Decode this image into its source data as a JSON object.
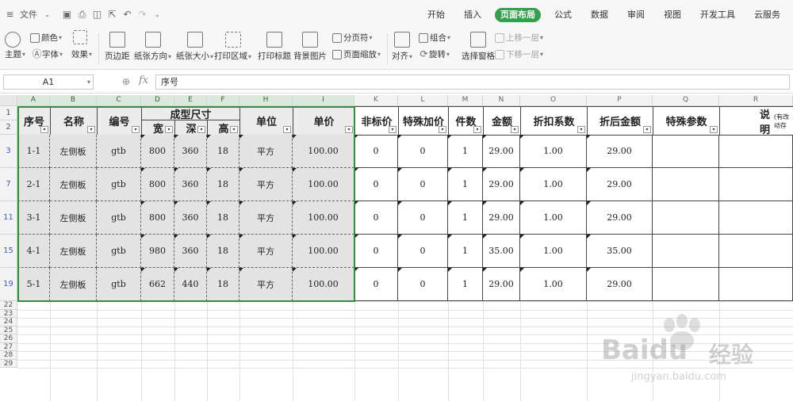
{
  "quick_access": {
    "menu_label": "文件"
  },
  "tabs": [
    "开始",
    "插入",
    "页面布局",
    "公式",
    "数据",
    "审阅",
    "视图",
    "开发工具",
    "云服务"
  ],
  "active_tab_index": 2,
  "ribbon": {
    "theme": "主题",
    "colors": "颜色",
    "fonts": "字体",
    "effects": "效果",
    "margins": "页边距",
    "orientation": "纸张方向",
    "size": "纸张大小",
    "print_area": "打印区域",
    "print_titles": "打印标题",
    "background": "背景图片",
    "breaks": "分页符",
    "page_zoom": "页面缩放",
    "align": "对齐",
    "group": "组合",
    "rotate": "旋转",
    "selection_pane": "选择窗格",
    "bring_forward": "上移一层",
    "send_backward": "下移一层"
  },
  "formula_bar": {
    "cell_ref": "A1",
    "fx": "fx",
    "content": "序号"
  },
  "columns": [
    "A",
    "B",
    "C",
    "D",
    "E",
    "F",
    "H",
    "I",
    "K",
    "L",
    "M",
    "N",
    "O",
    "P",
    "Q",
    "R"
  ],
  "header": {
    "seq": "序号",
    "name": "名称",
    "code": "编号",
    "size_group": "成型尺寸",
    "width": "宽",
    "depth": "深",
    "height": "高",
    "unit": "单位",
    "unit_price": "单价",
    "nonstd_price": "非标价",
    "special_price": "特殊加价",
    "qty": "件数",
    "amount": "金额",
    "discount": "折扣系数",
    "discounted_amount": "折后金额",
    "special_params": "特殊参数",
    "note": "说明",
    "note_hint": "(有改动存"
  },
  "rows": [
    {
      "row_no": "3",
      "seq": "1-1",
      "name": "左侧板",
      "code": "gtb",
      "width": "800",
      "depth": "360",
      "height": "18",
      "unit": "平方",
      "unit_price": "100.00",
      "nonstd": "0",
      "special": "0",
      "qty": "1",
      "amount": "29.00",
      "discount": "1.00",
      "discounted": "29.00"
    },
    {
      "row_no": "7",
      "seq": "2-1",
      "name": "左侧板",
      "code": "gtb",
      "width": "800",
      "depth": "360",
      "height": "18",
      "unit": "平方",
      "unit_price": "100.00",
      "nonstd": "0",
      "special": "0",
      "qty": "1",
      "amount": "29.00",
      "discount": "1.00",
      "discounted": "29.00"
    },
    {
      "row_no": "11",
      "seq": "3-1",
      "name": "左侧板",
      "code": "gtb",
      "width": "800",
      "depth": "360",
      "height": "18",
      "unit": "平方",
      "unit_price": "100.00",
      "nonstd": "0",
      "special": "0",
      "qty": "1",
      "amount": "29.00",
      "discount": "1.00",
      "discounted": "29.00"
    },
    {
      "row_no": "15",
      "seq": "4-1",
      "name": "左侧板",
      "code": "gtb",
      "width": "980",
      "depth": "360",
      "height": "18",
      "unit": "平方",
      "unit_price": "100.00",
      "nonstd": "0",
      "special": "0",
      "qty": "1",
      "amount": "35.00",
      "discount": "1.00",
      "discounted": "35.00"
    },
    {
      "row_no": "19",
      "seq": "5-1",
      "name": "左侧板",
      "code": "gtb",
      "width": "662",
      "depth": "440",
      "height": "18",
      "unit": "平方",
      "unit_price": "100.00",
      "nonstd": "0",
      "special": "0",
      "qty": "1",
      "amount": "29.00",
      "discount": "1.00",
      "discounted": "29.00"
    }
  ],
  "header_rows": [
    "1",
    "2"
  ],
  "empty_rows": [
    "22",
    "23",
    "24",
    "25",
    "26",
    "27",
    "28",
    "29"
  ],
  "watermark": {
    "brand": "Baidu",
    "product": "经验",
    "url": "jingyan.baidu.com"
  },
  "colors": {
    "accent": "#33a14b",
    "selection": "#2f8f3a"
  }
}
